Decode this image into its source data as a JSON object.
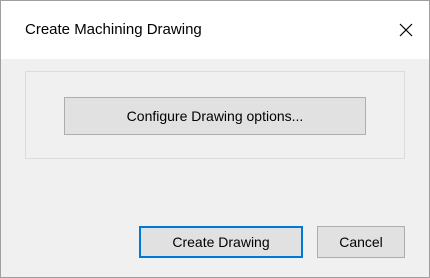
{
  "window": {
    "title": "Create Machining Drawing",
    "close_label": "Close"
  },
  "options_panel": {
    "configure_label": "Configure Drawing  options..."
  },
  "footer": {
    "create_label": "Create Drawing",
    "cancel_label": "Cancel"
  },
  "colors": {
    "dialog_background": "#f0f0f0",
    "title_background": "#ffffff",
    "button_background": "#e1e1e1",
    "button_border": "#adadad",
    "default_button_border": "#0078d7"
  }
}
